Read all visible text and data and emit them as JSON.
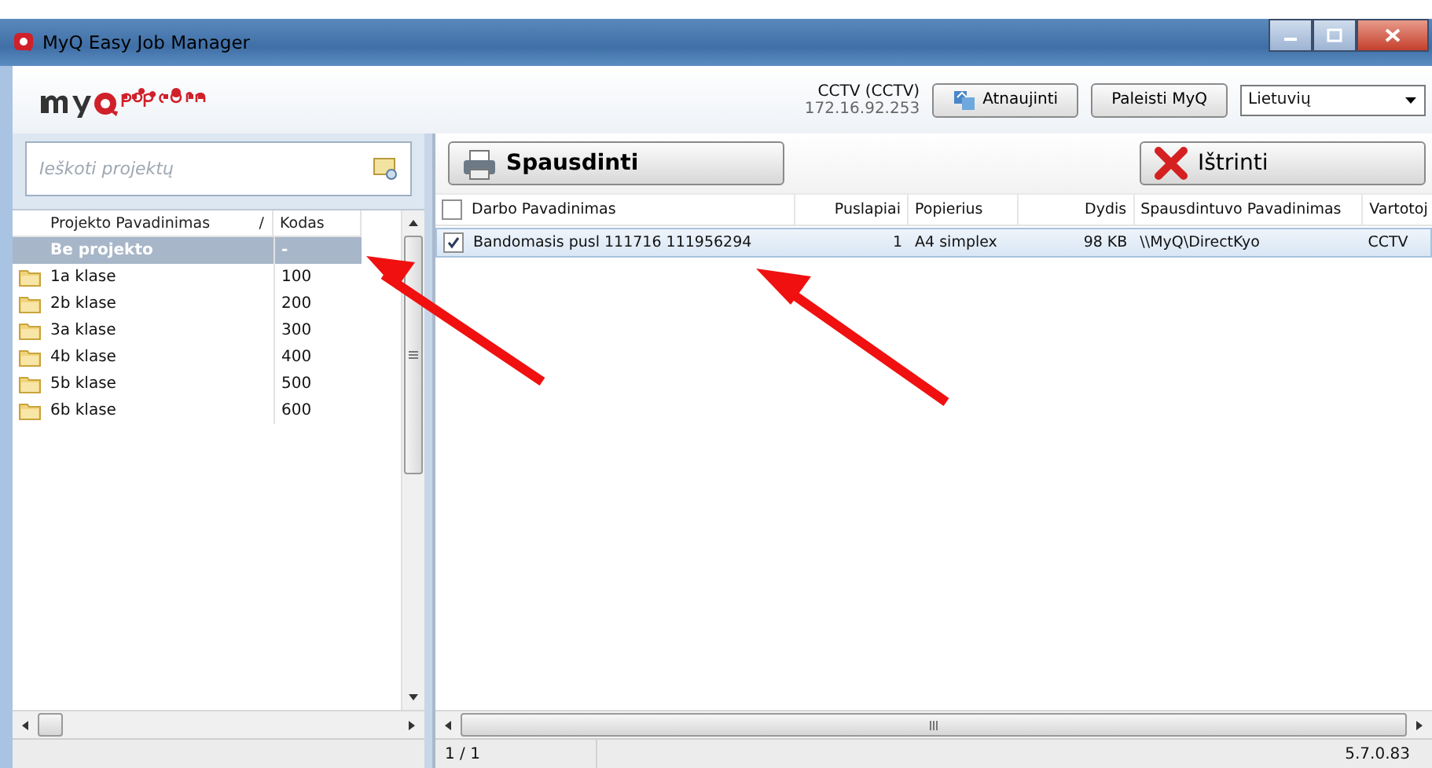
{
  "window": {
    "title": "MyQ Easy Job Manager"
  },
  "header": {
    "user": "CCTV (CCTV)",
    "address": "172.16.92.253",
    "buttons": [
      {
        "kind": "refresh",
        "label": "Atnaujinti"
      },
      {
        "kind": "plain",
        "label": "Paleisti MyQ"
      }
    ],
    "language": {
      "value": "Lietuvių"
    }
  },
  "projects": {
    "search": {
      "placeholder": "Ieškoti projektų"
    },
    "columns": [
      {
        "label": "Projekto Pavadinimas",
        "sort_indicator": "/"
      },
      {
        "label": "Kodas"
      }
    ],
    "rows": [
      {
        "name": "Be projekto",
        "code": "-",
        "kind": "none",
        "selected": true
      },
      {
        "name": "1a klase",
        "code": "100",
        "kind": "folder",
        "selected": false
      },
      {
        "name": "2b klase",
        "code": "200",
        "kind": "folder",
        "selected": false
      },
      {
        "name": "3a klase",
        "code": "300",
        "kind": "folder",
        "selected": false
      },
      {
        "name": "4b klase",
        "code": "400",
        "kind": "folder",
        "selected": false
      },
      {
        "name": "5b klase",
        "code": "500",
        "kind": "folder",
        "selected": false
      },
      {
        "name": "6b klase",
        "code": "600",
        "kind": "folder",
        "selected": false
      }
    ]
  },
  "jobs": {
    "toolbar": [
      {
        "kind": "print",
        "label": "Spausdinti"
      },
      {
        "kind": "delete",
        "label": "Ištrinti"
      }
    ],
    "all_checked": false,
    "columns": [
      "Darbo Pavadinimas",
      "Puslapiai",
      "Popierius",
      "Dydis",
      "Spausdintuvo Pavadinimas",
      "Vartotoj"
    ],
    "rows": [
      {
        "checked": true,
        "selected": true,
        "cells": [
          "Bandomasis pusl 111716 111956294",
          "1",
          "A4 simplex",
          "98 KB",
          "\\\\MyQ\\DirectKyo",
          "CCTV"
        ]
      }
    ]
  },
  "status_bar": {
    "page": "1 / 1",
    "version": "5.7.0.83"
  }
}
